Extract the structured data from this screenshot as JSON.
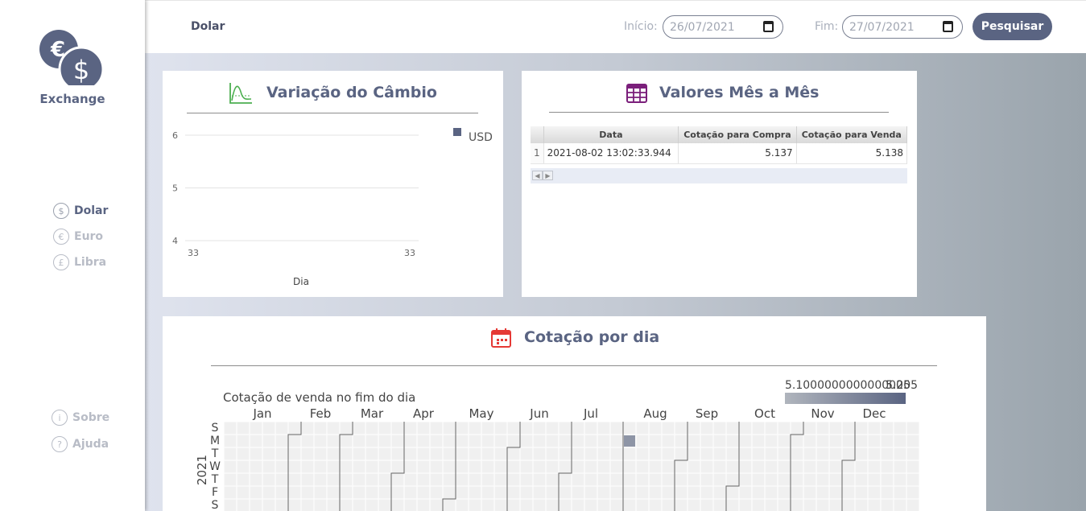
{
  "app": {
    "logo_text": "Exchange"
  },
  "sidebar": {
    "currencies": [
      {
        "label": "Dolar",
        "symbol": "$"
      },
      {
        "label": "Euro",
        "symbol": "€"
      },
      {
        "label": "Libra",
        "symbol": "£"
      }
    ],
    "bottom": [
      {
        "label": "Sobre",
        "symbol": "i"
      },
      {
        "label": "Ajuda",
        "symbol": "?"
      }
    ]
  },
  "topbar": {
    "title": "Dolar",
    "start_label": "Início:",
    "start_value": "26/07/2021",
    "end_label": "Fim:",
    "end_value": "27/07/2021",
    "search_label": "Pesquisar"
  },
  "variation_card": {
    "title": "Variação do Câmbio"
  },
  "table_card": {
    "title": "Valores Mês a Mês",
    "columns": [
      "Data",
      "Cotação para Compra",
      "Cotação para Venda"
    ],
    "rows": [
      {
        "index": "1",
        "data": "2021-08-02 13:02:33.944",
        "compra": "5.137",
        "venda": "5.138"
      }
    ]
  },
  "calendar_card": {
    "title": "Cotação por dia"
  },
  "colors": {
    "accent": "#5a6482",
    "green_icon": "#4caf50",
    "purple_icon": "#7b1f7b",
    "red_icon": "#e53935"
  },
  "chart_data": [
    {
      "type": "line",
      "title": "",
      "xlabel": "Dia",
      "ylabel": "",
      "x_ticks": [
        "33",
        "33"
      ],
      "y_ticks": [
        4,
        5,
        6
      ],
      "ylim": [
        4,
        6
      ],
      "grid": true,
      "legend_position": "top-right",
      "series": [
        {
          "name": "USD",
          "values": []
        }
      ]
    },
    {
      "type": "heatmap",
      "title": "Cotação de venda no fim do dia",
      "year": "2021",
      "months": [
        "Jan",
        "Feb",
        "Mar",
        "Apr",
        "May",
        "Jun",
        "Jul",
        "Aug",
        "Sep",
        "Oct",
        "Nov",
        "Dec"
      ],
      "weekdays": [
        "S",
        "M",
        "T",
        "W",
        "T",
        "F",
        "S"
      ],
      "colorbar_labels": [
        "5.1000000000000005",
        "5.2",
        "5.205"
      ],
      "cells": [
        {
          "date": "2021-08-02",
          "value": 5.138
        }
      ]
    }
  ]
}
